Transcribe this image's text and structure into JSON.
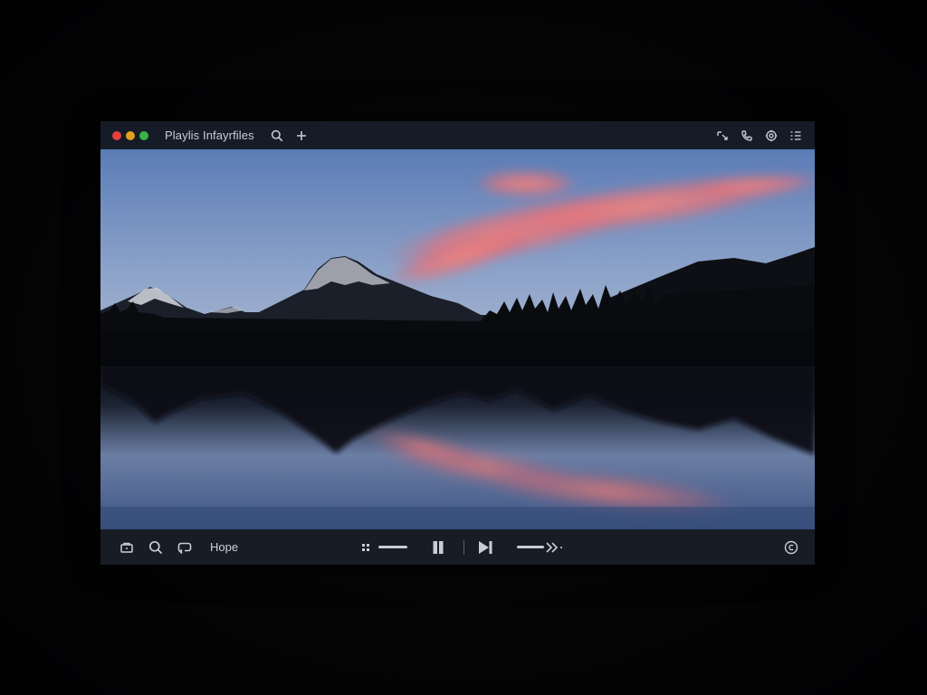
{
  "window": {
    "title": "Playlis Infayrfiles",
    "traffic_colors": [
      "#e5413a",
      "#e2a01f",
      "#37b44a"
    ]
  },
  "titlebar": {
    "left_icons": [
      "search-icon",
      "plus-icon"
    ],
    "right_icons": [
      "cast-icon",
      "phone-icon",
      "settings-icon",
      "list-icon"
    ]
  },
  "controls": {
    "left_icons": [
      "camera-icon",
      "search-icon",
      "loop-icon"
    ],
    "label": "Hope",
    "center_icons": [
      "playlist-icon",
      "pause-icon",
      "play-next-icon",
      "fast-forward-icon"
    ],
    "right_icons": [
      "copyright-icon"
    ]
  },
  "scene": {
    "sky_top": "#5d7fb8",
    "sky_bottom": "#a9b8d3",
    "cloud": "#ea7c78"
  }
}
